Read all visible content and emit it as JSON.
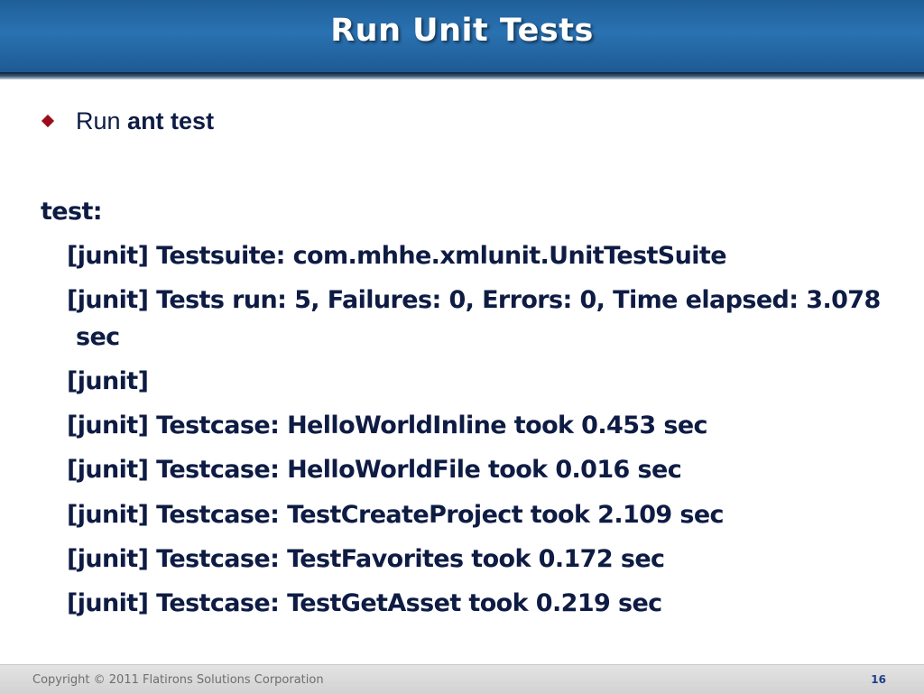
{
  "slide": {
    "title": "Run Unit Tests",
    "bullet": {
      "prefix": "Run ",
      "command": "ant test"
    },
    "output_label": "test:",
    "output_lines": [
      "[junit] Testsuite: com.mhhe.xmlunit.UnitTestSuite",
      "[junit] Tests run: 5, Failures: 0, Errors: 0, Time elapsed: 3.078",
      "sec",
      "[junit]",
      "[junit] Testcase: HelloWorldInline took 0.453 sec",
      "[junit] Testcase: HelloWorldFile took 0.016 sec",
      "[junit] Testcase: TestCreateProject took 2.109 sec",
      "[junit] Testcase: TestFavorites took 0.172 sec",
      "[junit] Testcase: TestGetAsset took 0.219 sec"
    ]
  },
  "footer": {
    "copyright": "Copyright © 2011 Flatirons Solutions Corporation",
    "page_number": "16"
  },
  "colors": {
    "header_blue": "#2a72b2",
    "bullet_red": "#9b0d1b",
    "text_navy": "#0e1c44",
    "page_number_blue": "#1d3f8a"
  }
}
